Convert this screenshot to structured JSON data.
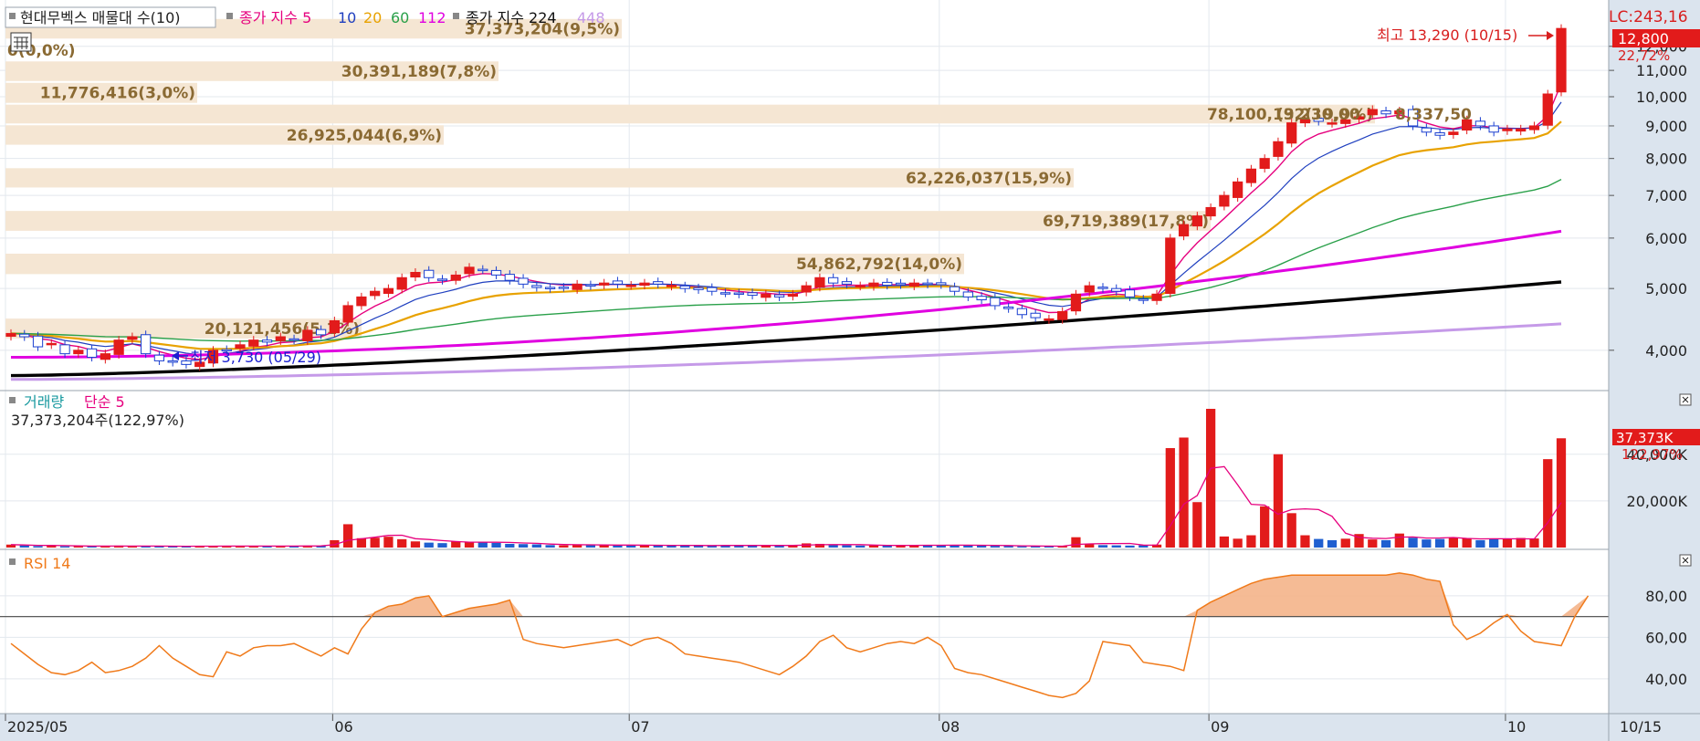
{
  "legend": {
    "title": "현대무벡스 매물대 수(10)",
    "ma_label": "종가 지수",
    "ma_periods": [
      "5",
      "10",
      "20",
      "60",
      "112"
    ],
    "ma2_label": "종가 지수 224",
    "ma2_extra": "448"
  },
  "right_axis": {
    "lc": "LC:243,16",
    "last_price": "12,800",
    "last_change": "22,72%"
  },
  "high_label": "최고 13,290 (10/15)",
  "low_label": "최저 3,730 (05/29)",
  "volume_panel": {
    "title": "거래량",
    "ma_label": "단순 5",
    "info": "37,373,204주(122,97%)",
    "last_value": "37,373K",
    "last_ratio": "122,97%"
  },
  "rsi_panel": {
    "title": "RSI 14"
  },
  "x_ticks": [
    "2025/05",
    "06",
    "07",
    "08",
    "09",
    "10"
  ],
  "last_date": "10/15",
  "chart_data": {
    "type": "candlestick",
    "price_axis": {
      "scale": "log",
      "ticks": [
        "4,000",
        "5,000",
        "6,000",
        "7,000",
        "8,000",
        "9,000",
        "10,000",
        "11,000",
        "12,000"
      ],
      "range": [
        3550,
        14000
      ]
    },
    "volume_axis": {
      "ticks": [
        "20,000K",
        "40,000K"
      ]
    },
    "rsi_axis": {
      "ticks": [
        "40,00",
        "60,00",
        "80,00"
      ],
      "range": [
        25,
        98
      ],
      "ref_line": 70
    },
    "volume_profile": [
      {
        "price_low": 12300,
        "price_high": 13290,
        "label": "37,373,204(9,5%)"
      },
      {
        "price_low": 11400,
        "price_high": 12300,
        "label": "0(0,0%)"
      },
      {
        "price_low": 10550,
        "price_high": 11400,
        "label": "30,391,189(7,8%)"
      },
      {
        "price_low": 9750,
        "price_high": 10550,
        "label": "11,776,416(3,0%)"
      },
      {
        "price_low": 9050,
        "price_high": 9750,
        "label": "78,100,132(19,9%)"
      },
      {
        "price_low": 8380,
        "price_high": 9050,
        "label": "26,925,044(6,9%)"
      },
      {
        "price_low": 7750,
        "price_high": 8380,
        "label": ""
      },
      {
        "price_low": 7180,
        "price_high": 7750,
        "label": "62,226,037(15,9%)"
      },
      {
        "price_low": 6640,
        "price_high": 7180,
        "label": ""
      },
      {
        "price_low": 6140,
        "price_high": 6640,
        "label": "69,719,389(17,8%)"
      },
      {
        "price_low": 5690,
        "price_high": 6140,
        "label": ""
      },
      {
        "price_low": 5250,
        "price_high": 5690,
        "label": "54,862,792(14,0%)"
      },
      {
        "price_low": 4860,
        "price_high": 5250,
        "label": ""
      },
      {
        "price_low": 4500,
        "price_high": 4860,
        "label": ""
      },
      {
        "price_low": 4160,
        "price_high": 4500,
        "label": "20,121,456(5,1%)"
      },
      {
        "price_low": 3730,
        "price_high": 4160,
        "label": ""
      }
    ],
    "volume_profile_extra_label": "9,230,00",
    "volume_profile_extra_label2": "8,337,50",
    "closes": [
      4250,
      4200,
      4050,
      4100,
      3950,
      4000,
      3900,
      3950,
      4150,
      4200,
      3950,
      3850,
      3830,
      3800,
      3830,
      4000,
      4000,
      4080,
      4150,
      4120,
      4200,
      4150,
      4300,
      4230,
      4450,
      4700,
      4850,
      4950,
      5000,
      5200,
      5300,
      5200,
      5150,
      5250,
      5400,
      5350,
      5250,
      5150,
      5080,
      5020,
      5000,
      5020,
      5080,
      5050,
      5100,
      5080,
      5060,
      5100,
      5080,
      5060,
      5000,
      4980,
      4950,
      4920,
      4900,
      4880,
      4900,
      4850,
      4900,
      5050,
      5200,
      5100,
      5080,
      5050,
      5100,
      5060,
      5070,
      5100,
      5080,
      5070,
      4950,
      4850,
      4800,
      4700,
      4650,
      4550,
      4500,
      4480,
      4600,
      4900,
      5050,
      5000,
      4950,
      4850,
      4800,
      4900,
      6000,
      6300,
      6500,
      6700,
      7000,
      7350,
      7700,
      8000,
      8500,
      9100,
      9200,
      9150,
      9100,
      9200,
      9300,
      9550,
      9400,
      9500,
      9000,
      8800,
      8700,
      8800,
      9200,
      9000,
      8800,
      8900,
      8900,
      9000,
      10100,
      12800
    ],
    "volumes": [
      1.2,
      0.9,
      0.6,
      0.7,
      0.5,
      0.6,
      0.5,
      0.6,
      0.8,
      0.5,
      0.6,
      0.5,
      0.4,
      0.6,
      0.7,
      0.6,
      0.6,
      0.5,
      0.6,
      0.6,
      0.6,
      0.6,
      0.8,
      0.7,
      3.0,
      9.5,
      3.8,
      4.0,
      4.4,
      3.4,
      2.5,
      2.0,
      1.8,
      2.6,
      2.1,
      2.4,
      1.9,
      1.5,
      1.4,
      1.3,
      1.0,
      0.9,
      1.2,
      1.1,
      1.0,
      0.9,
      0.9,
      1.0,
      0.8,
      0.8,
      0.9,
      0.8,
      0.8,
      0.9,
      0.9,
      0.8,
      0.9,
      0.8,
      0.9,
      1.7,
      1.5,
      1.0,
      0.9,
      0.8,
      0.9,
      0.8,
      0.9,
      1.1,
      1.0,
      0.9,
      1.0,
      0.9,
      0.9,
      0.7,
      0.6,
      0.5,
      0.5,
      0.6,
      0.6,
      4.2,
      1.5,
      1.0,
      0.9,
      0.8,
      0.9,
      1.2,
      40.5,
      44.8,
      18.5,
      56.5,
      4.5,
      3.6,
      5.0,
      16.8,
      38.0,
      14.0,
      5.0,
      3.5,
      3.0,
      3.6,
      5.5,
      3.3,
      3.0,
      5.7,
      4.0,
      3.3,
      3.5,
      4.0,
      3.8,
      3.0,
      3.5,
      3.5,
      3.9,
      3.7,
      36.0,
      44.5
    ],
    "rsi": [
      57,
      52,
      47,
      43,
      42,
      44,
      48,
      43,
      44,
      46,
      50,
      56,
      50,
      46,
      42,
      41,
      53,
      51,
      55,
      56,
      56,
      57,
      54,
      51,
      55,
      52,
      64,
      72,
      75,
      76,
      79,
      80,
      70,
      72,
      74,
      75,
      76,
      78,
      59,
      57,
      56,
      55,
      56,
      57,
      58,
      59,
      56,
      59,
      60,
      57,
      52,
      51,
      50,
      49,
      48,
      46,
      44,
      42,
      46,
      51,
      58,
      61,
      55,
      53,
      55,
      57,
      58,
      57,
      60,
      56,
      45,
      43,
      42,
      40,
      38,
      36,
      34,
      32,
      31,
      33,
      39,
      58,
      57,
      56,
      48,
      47,
      46,
      44,
      73,
      77,
      80,
      83,
      86,
      88,
      89,
      90,
      90,
      90,
      90,
      90,
      90,
      90,
      90,
      91,
      90,
      88,
      87,
      66,
      59,
      62,
      67,
      71,
      63,
      58,
      57,
      56,
      70,
      80
    ]
  }
}
